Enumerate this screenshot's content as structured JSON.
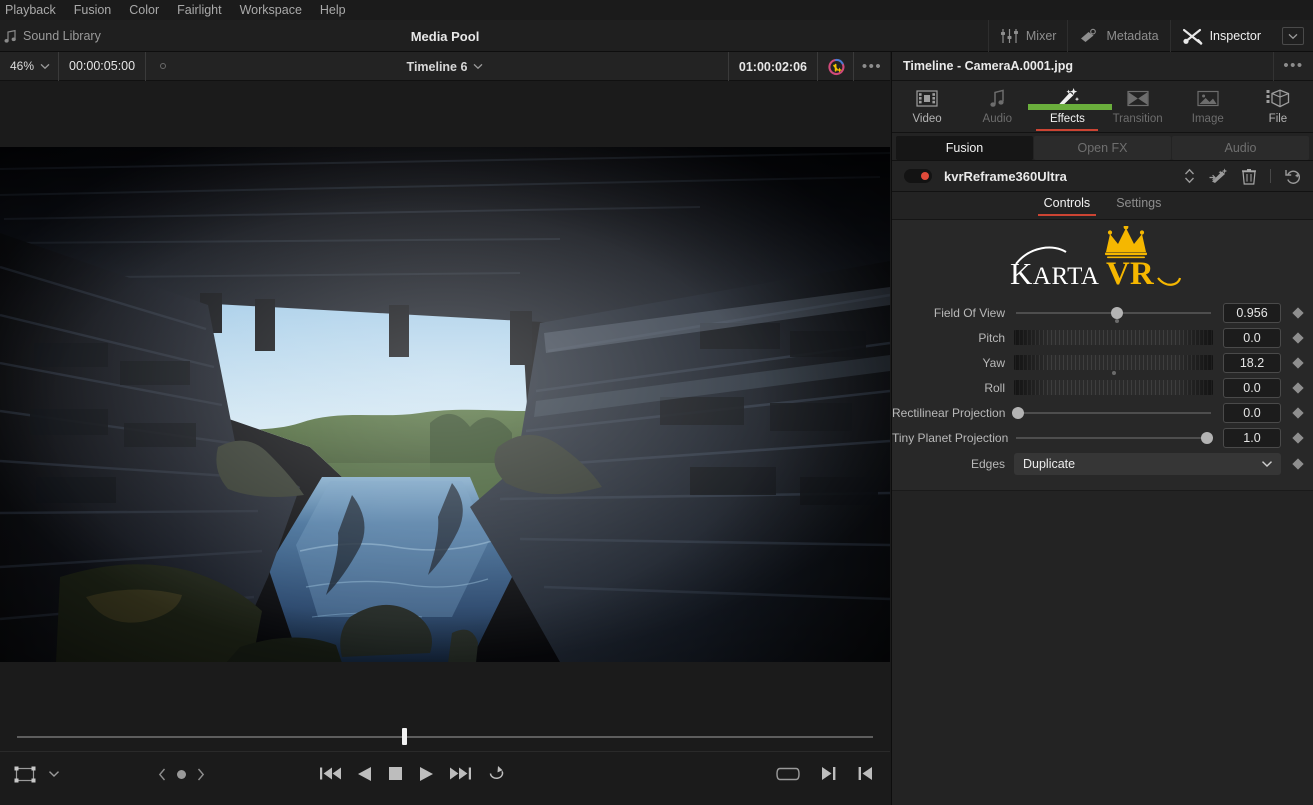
{
  "menubar": {
    "items": [
      {
        "label": "Playback",
        "name": "menu-playback"
      },
      {
        "label": "Fusion",
        "name": "menu-fusion"
      },
      {
        "label": "Color",
        "name": "menu-color"
      },
      {
        "label": "Fairlight",
        "name": "menu-fairlight"
      },
      {
        "label": "Workspace",
        "name": "menu-workspace"
      },
      {
        "label": "Help",
        "name": "menu-help"
      }
    ]
  },
  "toolbar": {
    "sound_library_label": "Sound Library",
    "media_pool_title": "Media Pool",
    "buttons": [
      {
        "label": "Mixer",
        "icon": "mixer-icon",
        "active": false
      },
      {
        "label": "Metadata",
        "icon": "metadata-icon",
        "active": false
      },
      {
        "label": "Inspector",
        "icon": "inspector-icon",
        "active": true
      }
    ],
    "chevron_icon": "chevron-down-icon"
  },
  "viewer": {
    "zoom_level": "46%",
    "zoom_chevron_icon": "chevron-down-icon",
    "timecode_in": "00:00:05:00",
    "marker_icon": "hollow-dot-icon",
    "timeline_name": "Timeline 6",
    "timeline_chevron_icon": "chevron-down-icon",
    "timecode_current": "01:00:02:06",
    "magic_icon": "color-wheel-icon",
    "options_icon": "more-options-icon",
    "image_description": "Dark wooden covered-bridge interior framing a bright sky and blue river",
    "transport": {
      "crop_icon": "transform-crop-icon",
      "crop_chevron_icon": "chevron-down-icon",
      "prev_keyframe_icon": "prev-keyframe-icon",
      "keyframe_icon": "keyframe-dot-icon",
      "next_keyframe_icon": "next-keyframe-icon",
      "jump_start_icon": "jump-to-start-icon",
      "play_reverse_icon": "play-reverse-icon",
      "stop_icon": "stop-icon",
      "play_icon": "play-icon",
      "jump_end_icon": "jump-to-end-icon",
      "loop_icon": "loop-icon",
      "fit_icon": "fit-to-screen-icon",
      "mark_out_icon": "mark-out-icon",
      "mark_in_icon": "mark-in-icon"
    }
  },
  "inspector": {
    "title": "Timeline - CameraA.0001.jpg",
    "options_icon": "more-options-icon",
    "category_tabs": [
      {
        "label": "Video",
        "icon": "film-strip-icon",
        "state": "enabled"
      },
      {
        "label": "Audio",
        "icon": "music-note-icon",
        "state": "disabled"
      },
      {
        "label": "Effects",
        "icon": "magic-wand-icon",
        "state": "selected"
      },
      {
        "label": "Transition",
        "icon": "transition-icon",
        "state": "disabled"
      },
      {
        "label": "Image",
        "icon": "image-icon",
        "state": "disabled"
      },
      {
        "label": "File",
        "icon": "file-cube-icon",
        "state": "enabled"
      }
    ],
    "accent_red": "#cc4433",
    "accent_green": "#6aae3c",
    "segments": [
      {
        "label": "Fusion",
        "selected": true
      },
      {
        "label": "Open FX",
        "selected": false
      },
      {
        "label": "Audio",
        "selected": false
      }
    ],
    "effect": {
      "name": "kvrReframe360Ultra",
      "enabled_toggle_icon": "power-toggle-icon",
      "toggle_color": "#e04a3a",
      "reorder_icon": "reorder-updown-icon",
      "apply_icon": "wand-apply-icon",
      "delete_icon": "trash-icon",
      "reset_icon": "reset-history-icon"
    },
    "sub_tabs": [
      {
        "label": "Controls",
        "selected": true
      },
      {
        "label": "Settings",
        "selected": false
      }
    ],
    "logo": {
      "word_one": "KARTA",
      "word_two": "VR",
      "crown_icon": "crown-icon",
      "gold": "#f5b700"
    },
    "params": [
      {
        "label": "Field Of View",
        "value": "0.956",
        "widget": "slider",
        "pos": 0.52,
        "substop": 0.52,
        "keyframe_icon": "keyframe-diamond-icon"
      },
      {
        "label": "Pitch",
        "value": "0.0",
        "widget": "wheel",
        "pos": 0.5,
        "substop": null,
        "keyframe_icon": "keyframe-diamond-icon"
      },
      {
        "label": "Yaw",
        "value": "18.2",
        "widget": "wheel",
        "pos": 0.5,
        "substop": 0.5,
        "keyframe_icon": "keyframe-diamond-icon"
      },
      {
        "label": "Roll",
        "value": "0.0",
        "widget": "wheel",
        "pos": 0.5,
        "substop": null,
        "keyframe_icon": "keyframe-diamond-icon"
      },
      {
        "label": "Rectilinear Projection",
        "value": "0.0",
        "widget": "slider",
        "pos": 0.0,
        "substop": null,
        "keyframe_icon": "keyframe-diamond-icon"
      },
      {
        "label": "Tiny Planet Projection",
        "value": "1.0",
        "widget": "slider",
        "pos": 1.0,
        "substop": null,
        "keyframe_icon": "keyframe-diamond-icon"
      },
      {
        "label": "Edges",
        "value": "Duplicate",
        "widget": "dropdown",
        "chevron_icon": "chevron-down-icon",
        "keyframe_icon": "keyframe-diamond-icon"
      }
    ]
  }
}
